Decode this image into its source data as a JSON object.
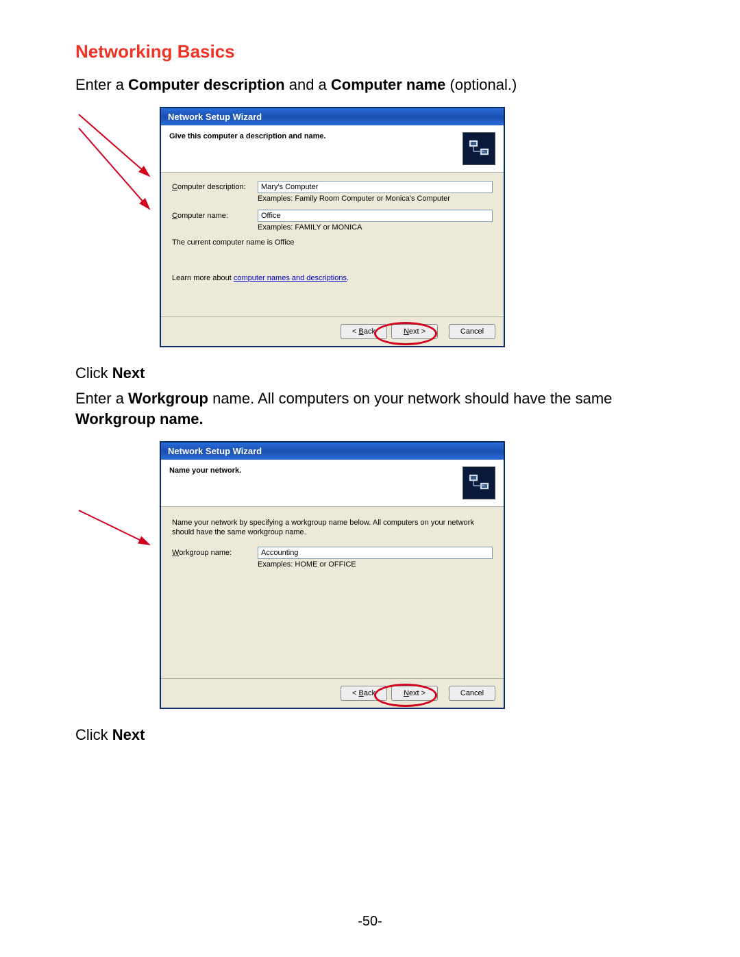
{
  "page": {
    "section_title": "Networking Basics",
    "intro_prefix": "Enter a ",
    "intro_b1": "Computer description",
    "intro_mid": " and a ",
    "intro_b2": "Computer name",
    "intro_suffix": " (optional.)",
    "click_next_prefix": "Click ",
    "click_next_bold": "Next",
    "para2_prefix": "Enter a ",
    "para2_b1": "Workgroup",
    "para2_mid": " name.    All computers on your network should have the same ",
    "para2_b2": "Workgroup name.",
    "page_number": "-50-"
  },
  "wizard1": {
    "title": "Network Setup Wizard",
    "header_title": "Give this computer a description and name.",
    "desc_label_pre": "C",
    "desc_label_rest": "omputer description:",
    "desc_value": "Mary's Computer",
    "desc_example": "Examples: Family Room Computer or Monica's Computer",
    "name_label_pre": "C",
    "name_label_rest": "omputer name:",
    "name_value": "Office",
    "name_example": "Examples: FAMILY or MONICA",
    "current_pre": "The current computer name is  ",
    "current_val": "Office",
    "learn_pre": "Learn more about ",
    "learn_link": "computer names and descriptions",
    "learn_post": ".",
    "back_pre": "< ",
    "back_u": "B",
    "back_rest": "ack",
    "next_u": "N",
    "next_rest": "ext >",
    "cancel": "Cancel"
  },
  "wizard2": {
    "title": "Network Setup Wizard",
    "header_title": "Name your network.",
    "instruction": "Name your network by specifying a workgroup name below. All computers on your network should have the same workgroup name.",
    "wg_label_pre": "W",
    "wg_label_rest": "orkgroup name:",
    "wg_value": "Accounting",
    "wg_example": "Examples: HOME or OFFICE",
    "back_pre": "< ",
    "back_u": "B",
    "back_rest": "ack",
    "next_u": "N",
    "next_rest": "ext >",
    "cancel": "Cancel"
  }
}
